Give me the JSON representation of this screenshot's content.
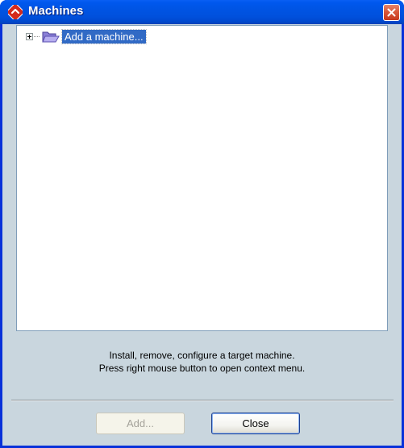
{
  "window": {
    "title": "Machines",
    "icon": "app-logo-icon",
    "close_icon": "close-icon"
  },
  "tree": {
    "items": [
      {
        "label": "Add a machine...",
        "icon": "folder-icon",
        "expanded": false,
        "selected": true
      }
    ]
  },
  "hint": {
    "line1": "Install, remove, configure a target machine.",
    "line2": "Press right mouse button to open context menu."
  },
  "buttons": {
    "add_label": "Add...",
    "add_enabled": false,
    "close_label": "Close"
  },
  "colors": {
    "titlebar": "#0054e3",
    "selection": "#316ac5",
    "dialog_background": "#c9d6de",
    "close_button": "#d9583a"
  }
}
